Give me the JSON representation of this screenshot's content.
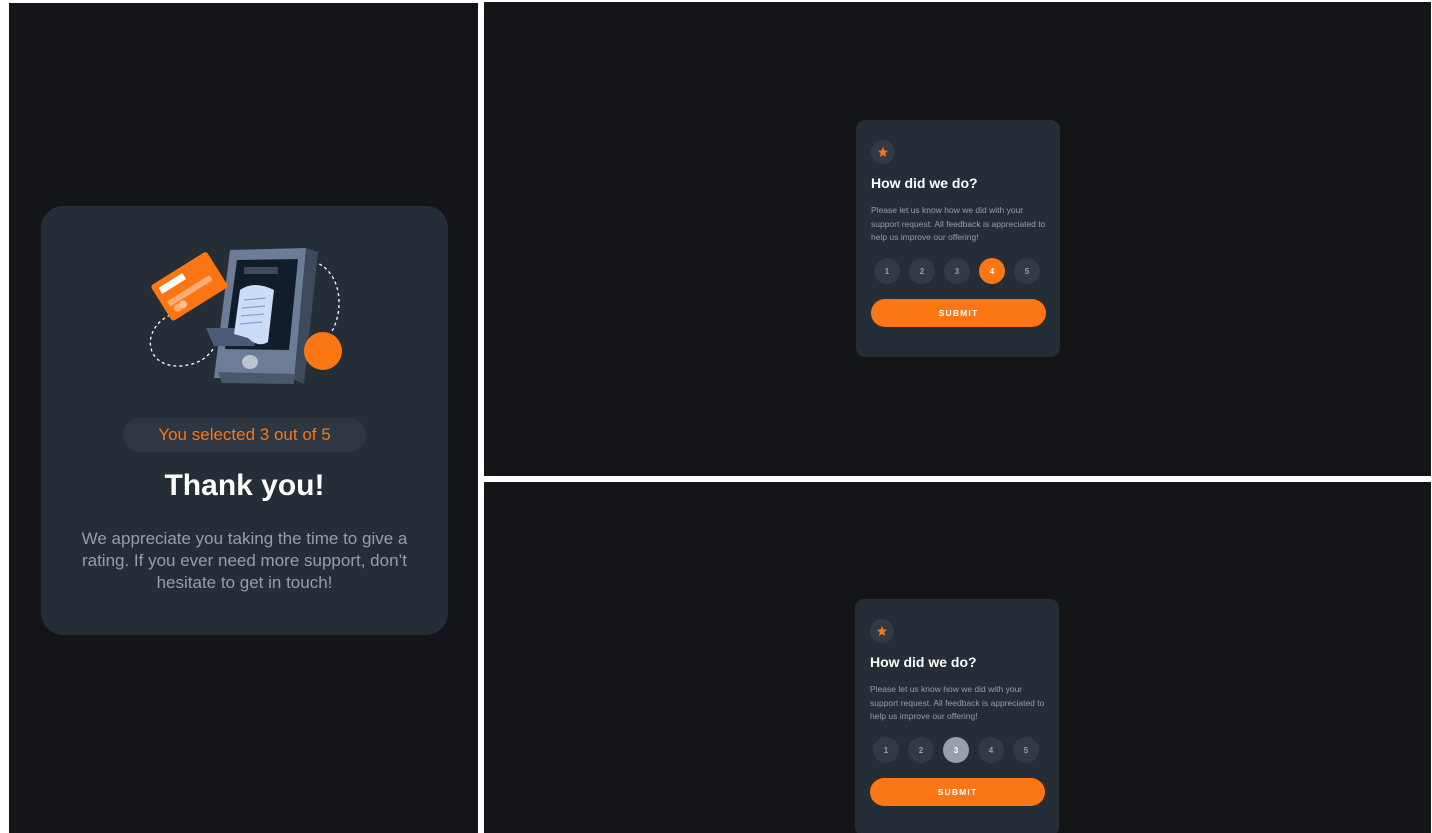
{
  "thank_you": {
    "selected_text": "You selected 3 out of 5",
    "title": "Thank you!",
    "message": "We appreciate you taking the time to give a rating. If you ever need more support, don’t hesitate to get in touch!"
  },
  "rating_top": {
    "title": "How did we do?",
    "description": "Please let us know how we did with your support request. All feedback is appreciated to help us improve our offering!",
    "options": [
      "1",
      "2",
      "3",
      "4",
      "5"
    ],
    "selected": "4",
    "submit_label": "SUBMIT"
  },
  "rating_bottom": {
    "title": "How did we do?",
    "description": "Please let us know how we did with your support request. All feedback is appreciated to help us improve our offering!",
    "options": [
      "1",
      "2",
      "3",
      "4",
      "5"
    ],
    "selected": "3",
    "submit_label": "SUBMIT"
  },
  "colors": {
    "background": "#131518",
    "card": "#252d37",
    "accent": "#fc7614",
    "muted_text": "#959eac",
    "button_bg": "#323a46"
  }
}
